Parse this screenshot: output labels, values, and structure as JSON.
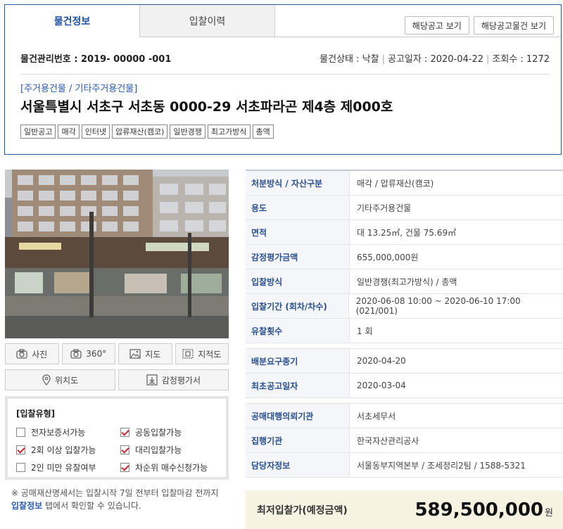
{
  "tabs": [
    {
      "label": "물건정보",
      "active": true
    },
    {
      "label": "입찰이력",
      "active": false
    }
  ],
  "header_buttons": {
    "notice_view": "해당공고 보기",
    "notice_items_view": "해당공고물건 보기"
  },
  "mgmt": {
    "label": "물건관리번호 : 2019- 00000 -001",
    "status": "물건상태 : 낙찰",
    "date": "공고일자 : 2020-04-22",
    "views": "조회수 : 1272"
  },
  "category": "[주거용건물 / 기타주거용건물]",
  "address": "서울특별시 서초구 서초동  0000-29 서초파라곤 제4층 제000호",
  "tags": [
    "일반공고",
    "매각",
    "인터넷",
    "압류재산(캠코)",
    "일반경쟁",
    "최고가방식",
    "총액"
  ],
  "media_buttons": [
    {
      "label": "사진",
      "icon": "camera-icon"
    },
    {
      "label": "360°",
      "icon": "camera-360-icon"
    },
    {
      "label": "지도",
      "icon": "image-map-icon"
    },
    {
      "label": "지적도",
      "icon": "cadastral-map-icon"
    }
  ],
  "location_buttons": [
    {
      "label": "위치도",
      "icon": "location-pin-icon"
    },
    {
      "label": "감정평가서",
      "icon": "download-icon"
    }
  ],
  "bid_type": {
    "title": "[입찰유형]",
    "items": [
      {
        "label": "전자보증서가능",
        "checked": false
      },
      {
        "label": "공동입찰가능",
        "checked": true
      },
      {
        "label": "2회 이상 입찰가능",
        "checked": true
      },
      {
        "label": "대리입찰가능",
        "checked": true
      },
      {
        "label": "2인 미만 유찰여부",
        "checked": false
      },
      {
        "label": "차순위 매수신청가능",
        "checked": true
      }
    ]
  },
  "notice": {
    "text1": "※ 공매재산명세서는 입찰시작 7일 전부터 입찰마감 전까지 ",
    "link": "입찰정보",
    "text2": " 탭에서 확인할 수 있습니다."
  },
  "details_a": [
    {
      "label": "처분방식 / 자산구분",
      "value": "매각 / 압류재산(캠코)"
    },
    {
      "label": "용도",
      "value": "기타주거용건물"
    },
    {
      "label": "면적",
      "value": "대 13.25㎡, 건물 75.69㎡"
    },
    {
      "label": "감정평가금액",
      "value": "655,000,000원"
    },
    {
      "label": "입찰방식",
      "value": "일반경쟁(최고가방식) / 총액"
    },
    {
      "label": "입찰기간 (회차/차수)",
      "value": "2020-06-08 10:00 ~ 2020-06-10 17:00 (021/001)"
    },
    {
      "label": "유찰횟수",
      "value": "1 회"
    }
  ],
  "details_b": [
    {
      "label": "배분요구종기",
      "value": "2020-04-20"
    },
    {
      "label": "최초공고일자",
      "value": "2020-03-04"
    }
  ],
  "details_c": [
    {
      "label": "공매대행의뢰기관",
      "value": "서초세무서"
    },
    {
      "label": "집행기관",
      "value": "한국자산관리공사"
    },
    {
      "label": "담당자정보",
      "value": "서울동부지역본부 / 조세정리2팀 / 1588-5321"
    }
  ],
  "price": {
    "label": "최저입찰가(예정금액)",
    "value": "589,500,000",
    "unit": "원"
  }
}
